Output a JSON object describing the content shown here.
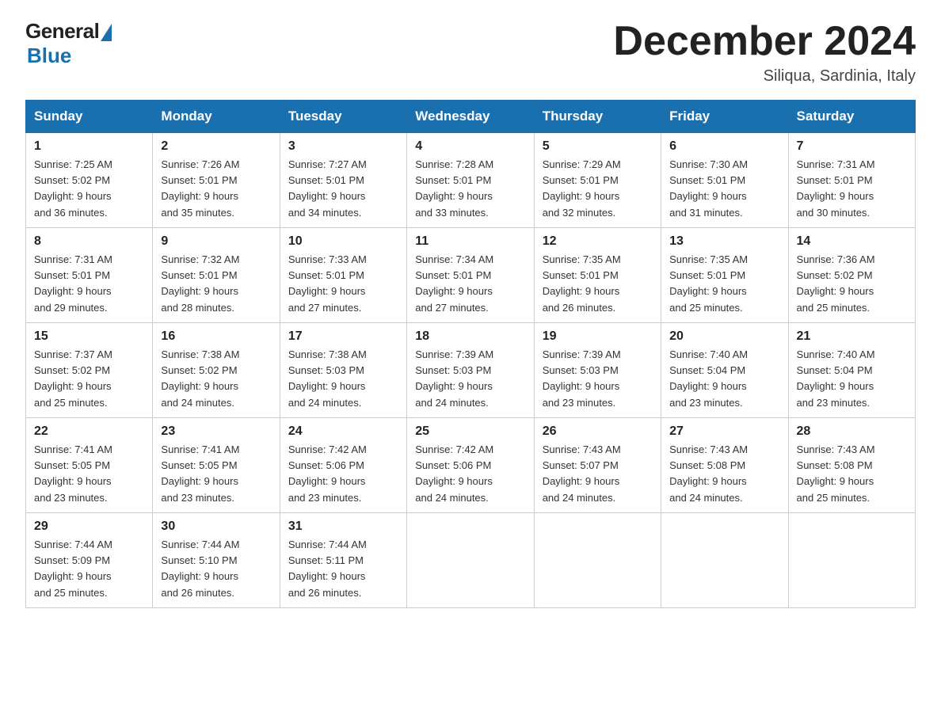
{
  "logo": {
    "general": "General",
    "blue": "Blue"
  },
  "title": "December 2024",
  "location": "Siliqua, Sardinia, Italy",
  "days_of_week": [
    "Sunday",
    "Monday",
    "Tuesday",
    "Wednesday",
    "Thursday",
    "Friday",
    "Saturday"
  ],
  "weeks": [
    [
      {
        "day": "1",
        "sunrise": "7:25 AM",
        "sunset": "5:02 PM",
        "daylight": "9 hours and 36 minutes."
      },
      {
        "day": "2",
        "sunrise": "7:26 AM",
        "sunset": "5:01 PM",
        "daylight": "9 hours and 35 minutes."
      },
      {
        "day": "3",
        "sunrise": "7:27 AM",
        "sunset": "5:01 PM",
        "daylight": "9 hours and 34 minutes."
      },
      {
        "day": "4",
        "sunrise": "7:28 AM",
        "sunset": "5:01 PM",
        "daylight": "9 hours and 33 minutes."
      },
      {
        "day": "5",
        "sunrise": "7:29 AM",
        "sunset": "5:01 PM",
        "daylight": "9 hours and 32 minutes."
      },
      {
        "day": "6",
        "sunrise": "7:30 AM",
        "sunset": "5:01 PM",
        "daylight": "9 hours and 31 minutes."
      },
      {
        "day": "7",
        "sunrise": "7:31 AM",
        "sunset": "5:01 PM",
        "daylight": "9 hours and 30 minutes."
      }
    ],
    [
      {
        "day": "8",
        "sunrise": "7:31 AM",
        "sunset": "5:01 PM",
        "daylight": "9 hours and 29 minutes."
      },
      {
        "day": "9",
        "sunrise": "7:32 AM",
        "sunset": "5:01 PM",
        "daylight": "9 hours and 28 minutes."
      },
      {
        "day": "10",
        "sunrise": "7:33 AM",
        "sunset": "5:01 PM",
        "daylight": "9 hours and 27 minutes."
      },
      {
        "day": "11",
        "sunrise": "7:34 AM",
        "sunset": "5:01 PM",
        "daylight": "9 hours and 27 minutes."
      },
      {
        "day": "12",
        "sunrise": "7:35 AM",
        "sunset": "5:01 PM",
        "daylight": "9 hours and 26 minutes."
      },
      {
        "day": "13",
        "sunrise": "7:35 AM",
        "sunset": "5:01 PM",
        "daylight": "9 hours and 25 minutes."
      },
      {
        "day": "14",
        "sunrise": "7:36 AM",
        "sunset": "5:02 PM",
        "daylight": "9 hours and 25 minutes."
      }
    ],
    [
      {
        "day": "15",
        "sunrise": "7:37 AM",
        "sunset": "5:02 PM",
        "daylight": "9 hours and 25 minutes."
      },
      {
        "day": "16",
        "sunrise": "7:38 AM",
        "sunset": "5:02 PM",
        "daylight": "9 hours and 24 minutes."
      },
      {
        "day": "17",
        "sunrise": "7:38 AM",
        "sunset": "5:03 PM",
        "daylight": "9 hours and 24 minutes."
      },
      {
        "day": "18",
        "sunrise": "7:39 AM",
        "sunset": "5:03 PM",
        "daylight": "9 hours and 24 minutes."
      },
      {
        "day": "19",
        "sunrise": "7:39 AM",
        "sunset": "5:03 PM",
        "daylight": "9 hours and 23 minutes."
      },
      {
        "day": "20",
        "sunrise": "7:40 AM",
        "sunset": "5:04 PM",
        "daylight": "9 hours and 23 minutes."
      },
      {
        "day": "21",
        "sunrise": "7:40 AM",
        "sunset": "5:04 PM",
        "daylight": "9 hours and 23 minutes."
      }
    ],
    [
      {
        "day": "22",
        "sunrise": "7:41 AM",
        "sunset": "5:05 PM",
        "daylight": "9 hours and 23 minutes."
      },
      {
        "day": "23",
        "sunrise": "7:41 AM",
        "sunset": "5:05 PM",
        "daylight": "9 hours and 23 minutes."
      },
      {
        "day": "24",
        "sunrise": "7:42 AM",
        "sunset": "5:06 PM",
        "daylight": "9 hours and 23 minutes."
      },
      {
        "day": "25",
        "sunrise": "7:42 AM",
        "sunset": "5:06 PM",
        "daylight": "9 hours and 24 minutes."
      },
      {
        "day": "26",
        "sunrise": "7:43 AM",
        "sunset": "5:07 PM",
        "daylight": "9 hours and 24 minutes."
      },
      {
        "day": "27",
        "sunrise": "7:43 AM",
        "sunset": "5:08 PM",
        "daylight": "9 hours and 24 minutes."
      },
      {
        "day": "28",
        "sunrise": "7:43 AM",
        "sunset": "5:08 PM",
        "daylight": "9 hours and 25 minutes."
      }
    ],
    [
      {
        "day": "29",
        "sunrise": "7:44 AM",
        "sunset": "5:09 PM",
        "daylight": "9 hours and 25 minutes."
      },
      {
        "day": "30",
        "sunrise": "7:44 AM",
        "sunset": "5:10 PM",
        "daylight": "9 hours and 26 minutes."
      },
      {
        "day": "31",
        "sunrise": "7:44 AM",
        "sunset": "5:11 PM",
        "daylight": "9 hours and 26 minutes."
      },
      null,
      null,
      null,
      null
    ]
  ],
  "labels": {
    "sunrise": "Sunrise:",
    "sunset": "Sunset:",
    "daylight": "Daylight:"
  }
}
